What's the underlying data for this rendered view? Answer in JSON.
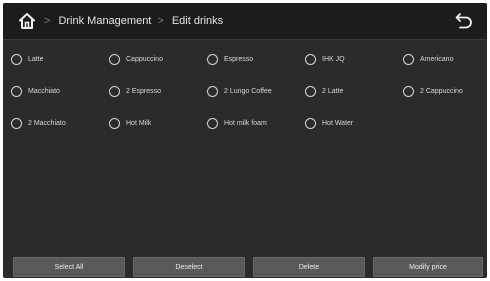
{
  "header": {
    "breadcrumb": [
      "Drink Management",
      "Edit drinks"
    ],
    "separator": ">"
  },
  "drinks": [
    "Latte",
    "Cappuccino",
    "Espresso",
    "IHK JQ",
    "Americano",
    "Macchiato",
    "2 Espresso",
    "2 Lungo Coffee",
    "2 Latte",
    "2 Cappuccino",
    "2 Macchiato",
    "Hot Milk",
    "Hot milk foam",
    "Hot Water"
  ],
  "actions": {
    "select_all": "Select All",
    "deselect": "Deselect",
    "delete": "Delete",
    "modify_price": "Modify price"
  },
  "colors": {
    "background": "#2b2b2b",
    "topbar": "#1c1c1c",
    "button": "#595959"
  }
}
